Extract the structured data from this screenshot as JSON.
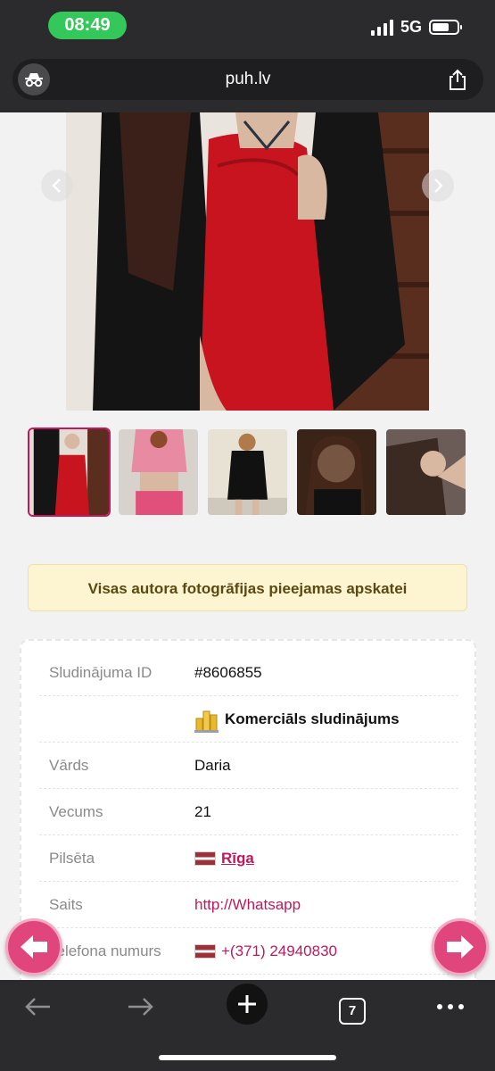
{
  "status_bar": {
    "time": "08:49",
    "network": "5G",
    "signal_bars": 4,
    "battery_level": 0.7
  },
  "browser": {
    "url": "puh.lv",
    "tab_count": "7"
  },
  "gallery": {
    "thumbnail_count": 5,
    "selected_thumbnail": 1
  },
  "notice": {
    "text": "Visas autora fotogrāfijas pieejamas apskatei"
  },
  "listing": {
    "rows": [
      {
        "key": "Sludinājuma ID",
        "value": "#8606855"
      },
      {
        "key": "",
        "value": "Komerciāls sludinājums"
      },
      {
        "key": "Vārds",
        "value": "Daria"
      },
      {
        "key": "Vecums",
        "value": "21"
      },
      {
        "key": "Pilsēta",
        "value": "Rīga"
      },
      {
        "key": "Saits",
        "value": "http://Whatsapp"
      },
      {
        "key": "Telefona numurs",
        "value": "+(371) 24940830"
      }
    ]
  },
  "colors": {
    "accent": "#c2185b",
    "fab": "#e0457b",
    "notice_bg": "#fdf4d2",
    "chrome": "#2b2b2d",
    "time_pill": "#34c759"
  },
  "icons": [
    "incognito-icon",
    "share-icon",
    "chevron-left-icon",
    "chevron-right-icon",
    "coins-icon",
    "flag-latvia-icon",
    "arrow-left-icon",
    "arrow-right-icon",
    "back-icon",
    "forward-icon",
    "plus-icon",
    "more-icon"
  ]
}
